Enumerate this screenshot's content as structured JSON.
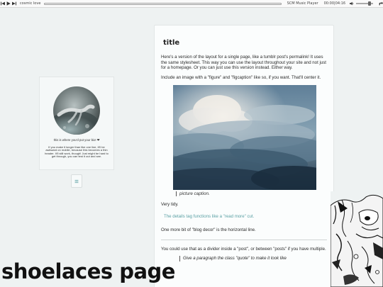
{
  "player": {
    "song": "cosmic love",
    "progress": 0.0,
    "brand": "SCM Music Player",
    "time": "00:00|04:16",
    "volume": 0.8
  },
  "sidebar": {
    "bio_short": "this is where you'd put your bio! ❤",
    "bio_long": "If you make it longer than like one line, it'll be awkward on mobile, because this becomes a thin header. It'll still work, though! Just might be hard to get through, you can test it out and see."
  },
  "post": {
    "title": "title",
    "p1": "Here's a version of the layout for a single page, like a tumblr post's permalink! It uses the same stylesheet. This way you can use the layout throughout your site and not just for a homepage. Or you can just use this version instead. Either way.",
    "p2": "Include an image with a \"figure\" and \"figcaption\" like so, if you want. That'll center it.",
    "figcaption": "picture caption.",
    "p3": "Very tidy.",
    "details": "The details tag functions like a \"read more\" cut.",
    "p4": "One more bit of \"blog decor\" is the horizontal line.",
    "p5": "You could use that as a divider inside a \"post\", or between \"posts\" if you have multiple.",
    "quote": "Give a paragraph the class \"quote\" to make it look like"
  },
  "site_title": "shoelaces page",
  "colors": {
    "background": "#eef2f2",
    "accent_link": "#5aa0a4",
    "card": "#fbfdfd"
  }
}
